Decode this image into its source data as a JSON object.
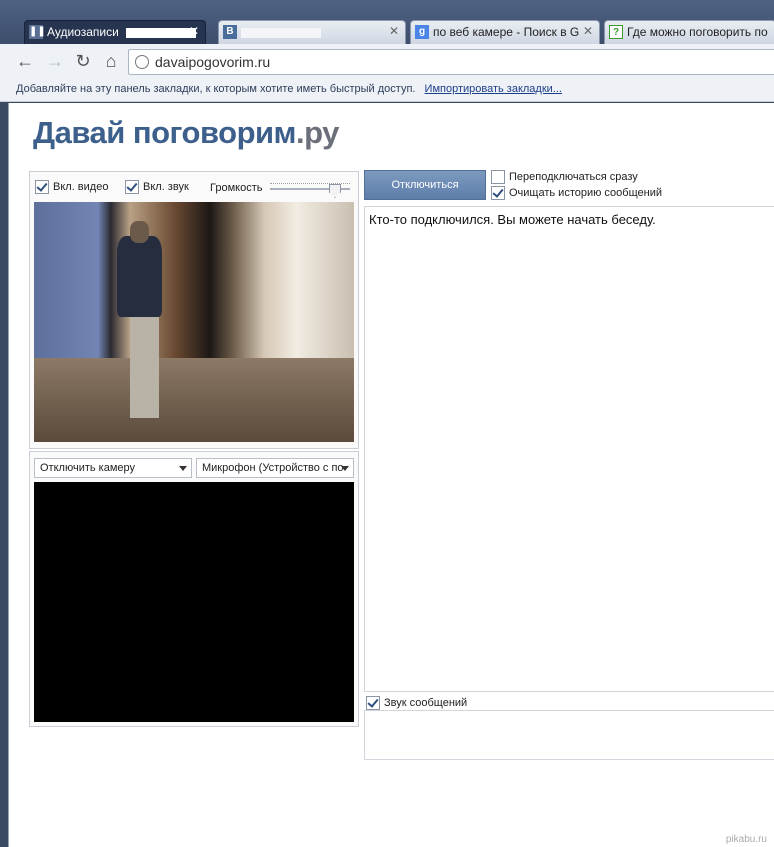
{
  "tabs": [
    {
      "title": "Аудиозаписи",
      "favicon": "pause-icon",
      "active": true
    },
    {
      "title": "",
      "favicon": "vk-icon",
      "active": false
    },
    {
      "title": "по веб камере - Поиск в G",
      "favicon": "google-icon",
      "active": false
    },
    {
      "title": "Где можно поговорить по",
      "favicon": "question-icon",
      "active": false
    }
  ],
  "toolbar": {
    "url": "davaipogovorim.ru"
  },
  "bookmarks_bar": {
    "text": "Добавляйте на эту панель закладки, к которым хотите иметь быстрый доступ.",
    "import_link": "Импортировать закладки..."
  },
  "logo": {
    "main": "Давай поговорим",
    "tld": ".ру"
  },
  "video_controls": {
    "video_label": "Вкл. видео",
    "video_on": true,
    "sound_label": "Вкл. звук",
    "sound_on": true,
    "volume_label": "Громкость",
    "volume_level": 0.8
  },
  "camera_select": {
    "selected": "Отключить камеру"
  },
  "mic_select": {
    "selected": "Микрофон (Устройство с по"
  },
  "chat": {
    "disconnect_button": "Отключиться",
    "reconnect_label": "Переподключаться сразу",
    "reconnect_on": false,
    "clear_history_label": "Очищать историю сообщений",
    "clear_history_on": true,
    "message": "Кто-то подключился. Вы можете начать беседу.",
    "sound_label": "Звук сообщений",
    "sound_on": true
  },
  "watermark": "pikabu.ru",
  "colors": {
    "brand": "#3c5f8c",
    "button": "#6a89b3"
  }
}
